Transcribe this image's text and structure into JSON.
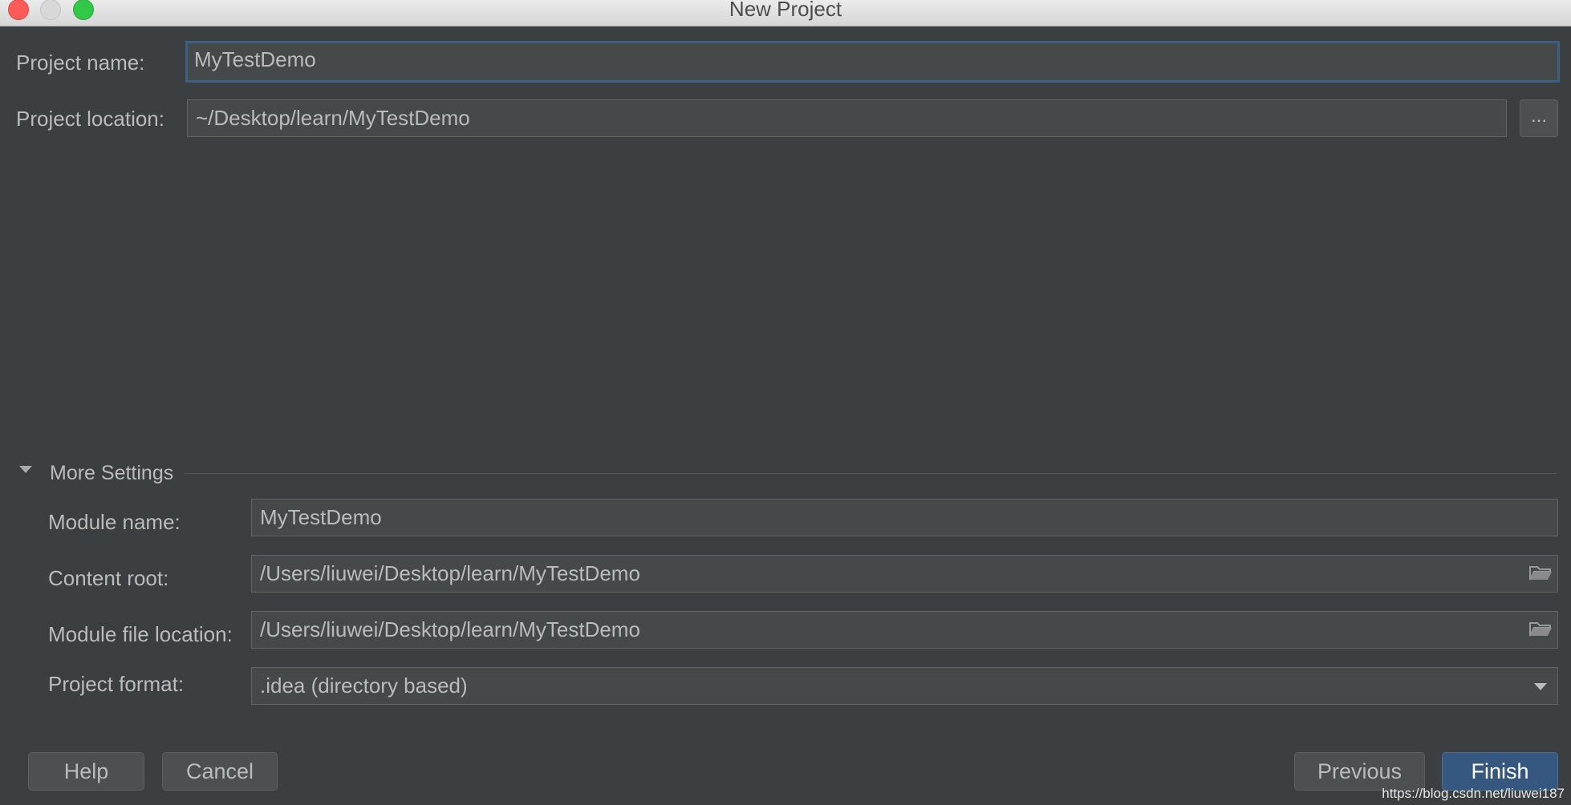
{
  "window": {
    "title": "New Project"
  },
  "project": {
    "name_label": "Project name:",
    "name_value": "MyTestDemo",
    "location_label": "Project location:",
    "location_value": "~/Desktop/learn/MyTestDemo",
    "browse_label": "..."
  },
  "more_settings": {
    "title": "More Settings",
    "expanded": true,
    "module_name_label": "Module name:",
    "module_name_value": "MyTestDemo",
    "content_root_label": "Content root:",
    "content_root_value": "/Users/liuwei/Desktop/learn/MyTestDemo",
    "module_file_label": "Module file location:",
    "module_file_value": "/Users/liuwei/Desktop/learn/MyTestDemo",
    "format_label": "Project format:",
    "format_value": ".idea (directory based)"
  },
  "footer": {
    "help": "Help",
    "cancel": "Cancel",
    "previous": "Previous",
    "finish": "Finish"
  },
  "watermark": "https://blog.csdn.net/liuwei187",
  "icons": {
    "close": "close-icon",
    "minimize": "minimize-icon",
    "maximize": "maximize-icon",
    "folder": "folder-icon",
    "chevron": "chevron-down-icon",
    "collapse": "triangle-down-icon"
  },
  "colors": {
    "background": "#3c3f41",
    "field_background": "#45494a",
    "focus_border": "#3d6185",
    "primary_button": "#365880"
  }
}
